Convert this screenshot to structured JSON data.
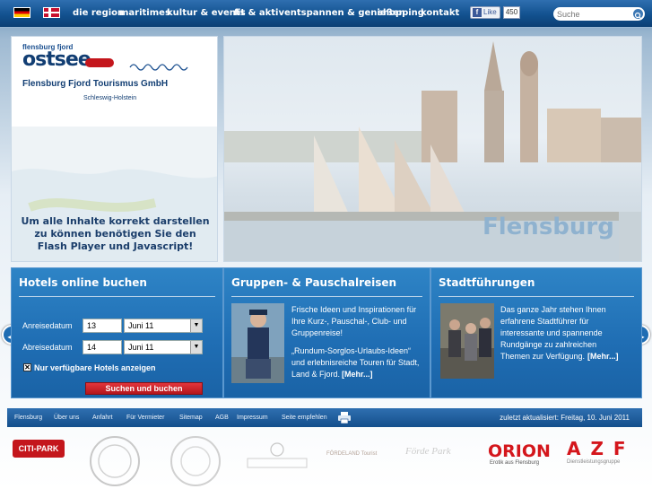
{
  "nav": {
    "items": [
      "die region",
      "maritimes",
      "kultur & events",
      "fit & aktiv",
      "entspannen & genießen",
      "shopping",
      "kontakt"
    ],
    "like_label": "Like",
    "like_count": "450",
    "search_placeholder": "Suche"
  },
  "hero": {
    "logo_small": "flensburg fjord",
    "logo_big": "ostsee",
    "logo_sub": "Schleswig-Holstein",
    "company": "Flensburg Fjord Tourismus GmbH",
    "flash_notice": [
      "Um alle Inhalte korrekt darstellen",
      "zu können benötigen Sie den",
      "Flash Player und Javascript!"
    ],
    "image_caption": "Flensburg"
  },
  "hotels": {
    "title": "Hotels online buchen",
    "arrival_label": "Anreisedatum",
    "arrival_day": "13",
    "arrival_month": "Juni 11",
    "departure_label": "Abreisedatum",
    "departure_day": "14",
    "departure_month": "Juni 11",
    "checkbox_label": "Nur verfügbare Hotels anzeigen",
    "submit_label": "Suchen und buchen"
  },
  "groups": {
    "title": "Gruppen- & Pauschalreisen",
    "text1": [
      "Frische Ideen und Inspirationen für",
      "Ihre Kurz-, Pauschal-, Club- und",
      "Gruppenreise!"
    ],
    "text2": [
      "„Rundum-Sorglos-Urlaubs-Ideen“",
      "und erlebnisreiche Touren für Stadt,",
      "Land & Fjord."
    ],
    "more": "[Mehr...]"
  },
  "tours": {
    "title": "Stadtführungen",
    "text": [
      "Das ganze Jahr stehen Ihnen",
      "erfahrene Stadtführer für",
      "interessante und spannende",
      "Rundgänge zu zahlreichen",
      "Themen zur Verfügung."
    ],
    "more": "[Mehr...]"
  },
  "footer": {
    "links": [
      "Flensburg",
      "Über uns",
      "Anfahrt",
      "Für Vermieter",
      "Sitemap",
      "AGB",
      "Impressum",
      "Seite empfehlen"
    ],
    "updated": "zuletzt aktualisiert: Freitag, 10. Juni 2011"
  },
  "partners": {
    "citi_park": "CITI-PARK",
    "foerdeland": "FÖRDELAND Tourist",
    "foerde_park": "Förde Park",
    "orion": "ORION",
    "orion_sub": "Erotik aus Flensburg",
    "azf": "A Z F",
    "azf_sub": "Dienstleistungsgruppe"
  },
  "colors": {
    "nav_blue": "#12518f",
    "box_blue": "#1f6db3",
    "submit_red": "#c41e25",
    "orion_red": "#d4161c"
  }
}
